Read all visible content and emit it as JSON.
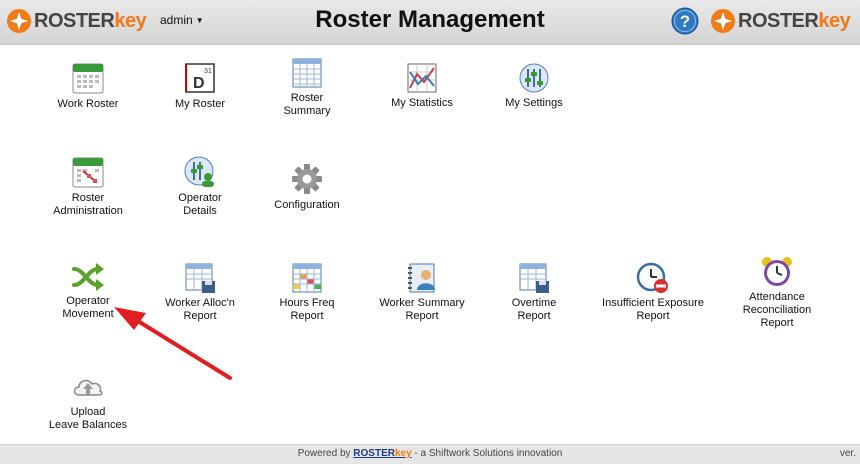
{
  "header": {
    "brand_left_a": "ROSTER",
    "brand_left_b": "key",
    "user": "admin",
    "title": "Roster Management",
    "brand_right_a": "ROSTER",
    "brand_right_b": "key"
  },
  "tiles": {
    "work_roster": "Work Roster",
    "my_roster": "My Roster",
    "roster_summary": "Roster\nSummary",
    "my_statistics": "My Statistics",
    "my_settings": "My Settings",
    "roster_admin": "Roster\nAdministration",
    "operator_details": "Operator\nDetails",
    "configuration": "Configuration",
    "operator_movement": "Operator\nMovement",
    "worker_alloc": "Worker Alloc'n\nReport",
    "hours_freq": "Hours Freq\nReport",
    "worker_summary": "Worker Summary\nReport",
    "overtime": "Overtime\nReport",
    "insufficient": "Insufficient Exposure\nReport",
    "attendance": "Attendance\nReconciliation\nReport",
    "upload": "Upload\nLeave Balances"
  },
  "icons": {
    "my_roster_letter": "D",
    "my_roster_day": "31"
  },
  "footer": {
    "powered_by": "Powered by ",
    "brand_a": "ROSTER",
    "brand_b": "key",
    "tagline": " - a Shiftwork Solutions innovation",
    "ver": "ver."
  },
  "colors": {
    "accent_orange": "#f07b1a",
    "arrow_red": "#e02020",
    "help_blue": "#2f78c4"
  }
}
